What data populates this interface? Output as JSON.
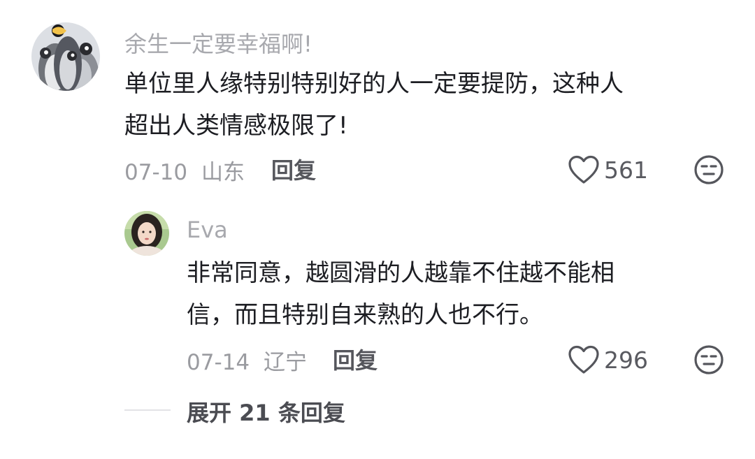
{
  "comments": [
    {
      "username": "余生一定要幸福啊!",
      "content_lines": [
        "单位里人缘特别特别好的人一定要提防，这种人",
        "超出人类情感极限了!"
      ],
      "date": "07-10",
      "location": "山东",
      "reply_label": "回复",
      "likes": "561",
      "avatar_icon": "penguin-avatar-icon",
      "like_icon": "heart-outline-icon",
      "dislike_icon": "neutral-face-icon"
    },
    {
      "username": "Eva",
      "content_lines": [
        "非常同意，越圆滑的人越靠不住越不能相",
        "信，而且特别自来熟的人也不行。"
      ],
      "date": "07-14",
      "location": "辽宁",
      "reply_label": "回复",
      "likes": "296",
      "avatar_icon": "portrait-avatar-icon",
      "like_icon": "heart-outline-icon",
      "dislike_icon": "neutral-face-icon"
    }
  ],
  "expand_replies": "展开 21 条回复",
  "colors": {
    "text_primary": "#1c1d22",
    "text_secondary": "#a8a9ae",
    "text_meta": "#9a9ba0",
    "icon": "#55565c"
  }
}
